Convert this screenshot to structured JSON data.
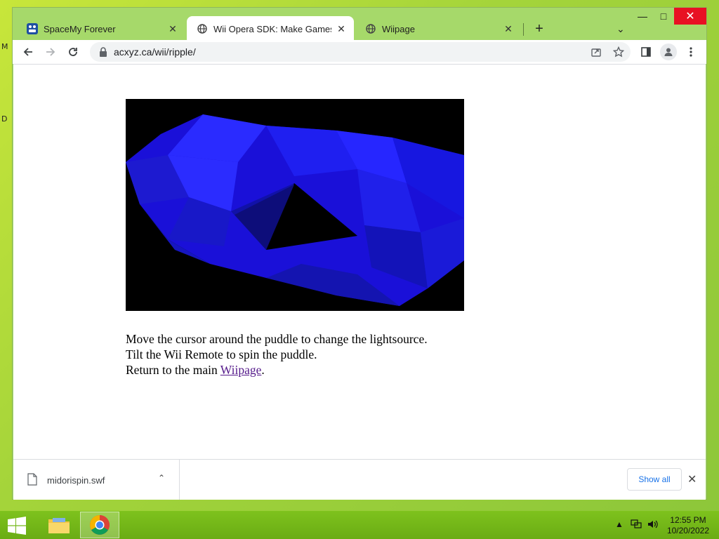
{
  "desktop": {
    "marks": [
      "M",
      "D"
    ]
  },
  "tabs": [
    {
      "title": "SpaceMy Forever",
      "icon": "spacemy-favicon-icon",
      "active": false
    },
    {
      "title": "Wii Opera SDK: Make Games for",
      "icon": "globe-icon",
      "active": true
    },
    {
      "title": "Wiipage",
      "icon": "globe-icon",
      "active": false
    }
  ],
  "toolbar": {
    "url": "acxyz.ca/wii/ripple/"
  },
  "page": {
    "line1": "Move the cursor around the puddle to change the lightsource.",
    "line2": "Tilt the Wii Remote to spin the puddle.",
    "line3_prefix": "Return to the main ",
    "line3_link": "Wiipage",
    "line3_suffix": "."
  },
  "downloads": {
    "file_name": "midorispin.swf",
    "show_all": "Show all"
  },
  "taskbar": {
    "time": "12:55 PM",
    "date": "10/20/2022"
  },
  "colors": {
    "desktop_accent": "#a6d96a",
    "ripple_blue": "#1a1aff",
    "link": "#551a8b",
    "close_red": "#e81123"
  }
}
